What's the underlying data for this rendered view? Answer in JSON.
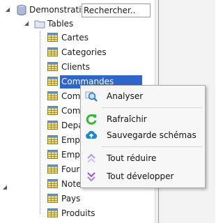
{
  "tree": {
    "root_label": "Demonstration",
    "search_value": "Rechercher..",
    "tables_label": "Tables",
    "items": [
      "Cartes",
      "Categories",
      "Clients",
      "Commandes",
      "Comm",
      "Comm",
      "Depar",
      "Emplo",
      "Emplo",
      "Fourn",
      "NoteD",
      "Pays",
      "Produits"
    ],
    "selected_item": "Commandes"
  },
  "context_menu": {
    "items": [
      {
        "label": "Analyser",
        "icon": "magnifier-icon"
      },
      {
        "label": "Rafraîchir",
        "icon": "refresh-icon"
      },
      {
        "label": "Sauvegarde schémas",
        "icon": "cloud-upload-icon"
      },
      {
        "label": "Tout réduire",
        "icon": "chevrons-up-icon"
      },
      {
        "label": "Tout développer",
        "icon": "chevrons-down-icon"
      }
    ]
  },
  "colors": {
    "selection": "#2e66c9",
    "refresh_green": "#36b536",
    "cloud_blue": "#1e88c8",
    "chevron_purple": "#9a55d6"
  }
}
